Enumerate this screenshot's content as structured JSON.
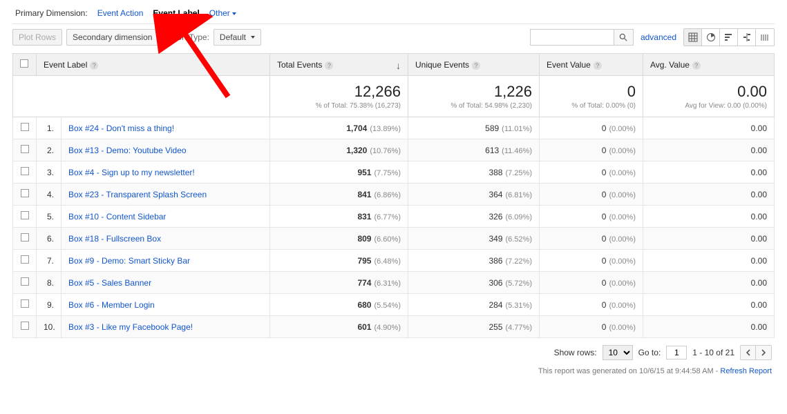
{
  "primary_dimension": {
    "label": "Primary Dimension:",
    "event_action": "Event Action",
    "event_label": "Event Label",
    "other": "Other"
  },
  "toolbar": {
    "plot_rows": "Plot Rows",
    "secondary_dimension": "Secondary dimension",
    "sort_type_label": "Sort Type:",
    "sort_type_value": "Default",
    "advanced": "advanced"
  },
  "columns": {
    "event_label": "Event Label",
    "total_events": "Total Events",
    "unique_events": "Unique Events",
    "event_value": "Event Value",
    "avg_value": "Avg. Value"
  },
  "summary": {
    "total_events": {
      "value": "12,266",
      "sub": "% of Total: 75.38% (16,273)"
    },
    "unique_events": {
      "value": "1,226",
      "sub": "% of Total: 54.98% (2,230)"
    },
    "event_value": {
      "value": "0",
      "sub": "% of Total: 0.00% (0)"
    },
    "avg_value": {
      "value": "0.00",
      "sub": "Avg for View: 0.00 (0.00%)"
    }
  },
  "rows": [
    {
      "idx": "1.",
      "name": "Box #24 - Don't miss a thing!",
      "total": "1,704",
      "total_pct": "(13.89%)",
      "unique": "589",
      "unique_pct": "(11.01%)",
      "value": "0",
      "value_pct": "(0.00%)",
      "avg": "0.00"
    },
    {
      "idx": "2.",
      "name": "Box #13 - Demo: Youtube Video",
      "total": "1,320",
      "total_pct": "(10.76%)",
      "unique": "613",
      "unique_pct": "(11.46%)",
      "value": "0",
      "value_pct": "(0.00%)",
      "avg": "0.00"
    },
    {
      "idx": "3.",
      "name": "Box #4 - Sign up to my newsletter!",
      "total": "951",
      "total_pct": "(7.75%)",
      "unique": "388",
      "unique_pct": "(7.25%)",
      "value": "0",
      "value_pct": "(0.00%)",
      "avg": "0.00"
    },
    {
      "idx": "4.",
      "name": "Box #23 - Transparent Splash Screen",
      "total": "841",
      "total_pct": "(6.86%)",
      "unique": "364",
      "unique_pct": "(6.81%)",
      "value": "0",
      "value_pct": "(0.00%)",
      "avg": "0.00"
    },
    {
      "idx": "5.",
      "name": "Box #10 - Content Sidebar",
      "total": "831",
      "total_pct": "(6.77%)",
      "unique": "326",
      "unique_pct": "(6.09%)",
      "value": "0",
      "value_pct": "(0.00%)",
      "avg": "0.00"
    },
    {
      "idx": "6.",
      "name": "Box #18 - Fullscreen Box",
      "total": "809",
      "total_pct": "(6.60%)",
      "unique": "349",
      "unique_pct": "(6.52%)",
      "value": "0",
      "value_pct": "(0.00%)",
      "avg": "0.00"
    },
    {
      "idx": "7.",
      "name": "Box #9 - Demo: Smart Sticky Bar",
      "total": "795",
      "total_pct": "(6.48%)",
      "unique": "386",
      "unique_pct": "(7.22%)",
      "value": "0",
      "value_pct": "(0.00%)",
      "avg": "0.00"
    },
    {
      "idx": "8.",
      "name": "Box #5 - Sales Banner",
      "total": "774",
      "total_pct": "(6.31%)",
      "unique": "306",
      "unique_pct": "(5.72%)",
      "value": "0",
      "value_pct": "(0.00%)",
      "avg": "0.00"
    },
    {
      "idx": "9.",
      "name": "Box #6 - Member Login",
      "total": "680",
      "total_pct": "(5.54%)",
      "unique": "284",
      "unique_pct": "(5.31%)",
      "value": "0",
      "value_pct": "(0.00%)",
      "avg": "0.00"
    },
    {
      "idx": "10.",
      "name": "Box #3 - Like my Facebook Page!",
      "total": "601",
      "total_pct": "(4.90%)",
      "unique": "255",
      "unique_pct": "(4.77%)",
      "value": "0",
      "value_pct": "(0.00%)",
      "avg": "0.00"
    }
  ],
  "pager": {
    "show_rows_label": "Show rows:",
    "show_rows_value": "10",
    "goto_label": "Go to:",
    "goto_value": "1",
    "range": "1 - 10 of 21"
  },
  "footer": {
    "text": "This report was generated on 10/6/15 at 9:44:58 AM - ",
    "refresh": "Refresh Report"
  }
}
